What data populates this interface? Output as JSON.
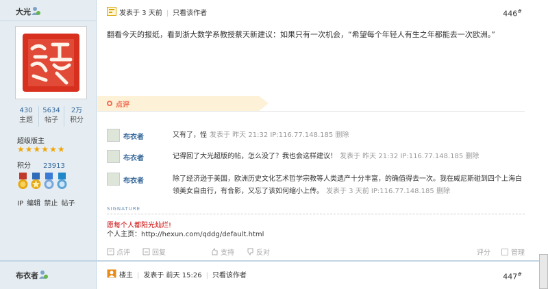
{
  "post1": {
    "author": "大光",
    "avatar_alt": "seal-avatar",
    "stats": [
      {
        "value": "430",
        "label": "主题"
      },
      {
        "value": "5634",
        "label": "帖子"
      },
      {
        "value": "2万",
        "label": "积分"
      }
    ],
    "rank": "超级版主",
    "stars": [
      "★",
      "★",
      "★",
      "★",
      "★",
      "★"
    ],
    "points_label": "积分",
    "points_value": "23913",
    "actions": "IP 编辑 禁止 帖子",
    "posted": "发表于 3 天前",
    "only_author": "只看该作者",
    "floor": "446",
    "floor_sup": "#",
    "content": "翻看今天的报纸，看到浙大数学系教授蔡天新建议：如果只有一次机会，“希望每个年轻人有生之年都能去一次欧洲。”",
    "comment_label": "点评",
    "comments": [
      {
        "name": "布衣者",
        "text": "又有了，怪",
        "meta": "发表于 昨天 21:32 IP:116.77.148.185 删除"
      },
      {
        "name": "布衣者",
        "text": "记得回了大光超版的帖，怎么没了？我也会这样建议！",
        "meta": "发表于 昨天 21:32 IP:116.77.148.185 删除"
      },
      {
        "name": "布衣者",
        "text": "除了经济逊于美国，欧洲历史文化艺术哲学宗教等人类遗产十分丰富，的确值得去一次。我在威尼斯碰到四个上海白领美女自由行，有合影，又忘了该如何缩小上传。",
        "meta": "发表于 3 天前 IP:116.77.148.185 删除"
      }
    ],
    "signature_label": "SIGNATURE",
    "signature_line1": "愿每个人都阳光灿烂!",
    "signature_line2": "个人主页：http://hexun.com/qddg/default.html",
    "footer": {
      "rate_btn": "点评",
      "reply_btn": "回复",
      "support_btn": "支持",
      "oppose_btn": "反对",
      "score": "评分",
      "manage": "管理"
    }
  },
  "post2": {
    "author": "布衣者",
    "role": "楼主",
    "posted": "发表于 前天 15:26",
    "only_author": "只看该作者",
    "floor": "447",
    "floor_sup": "#"
  },
  "colors": {
    "sidebar_bg": "#e5edf2",
    "border": "#c2d5e3",
    "link": "#336699",
    "comment_accent": "#f26c4f",
    "signature_red": "#cc0000"
  }
}
